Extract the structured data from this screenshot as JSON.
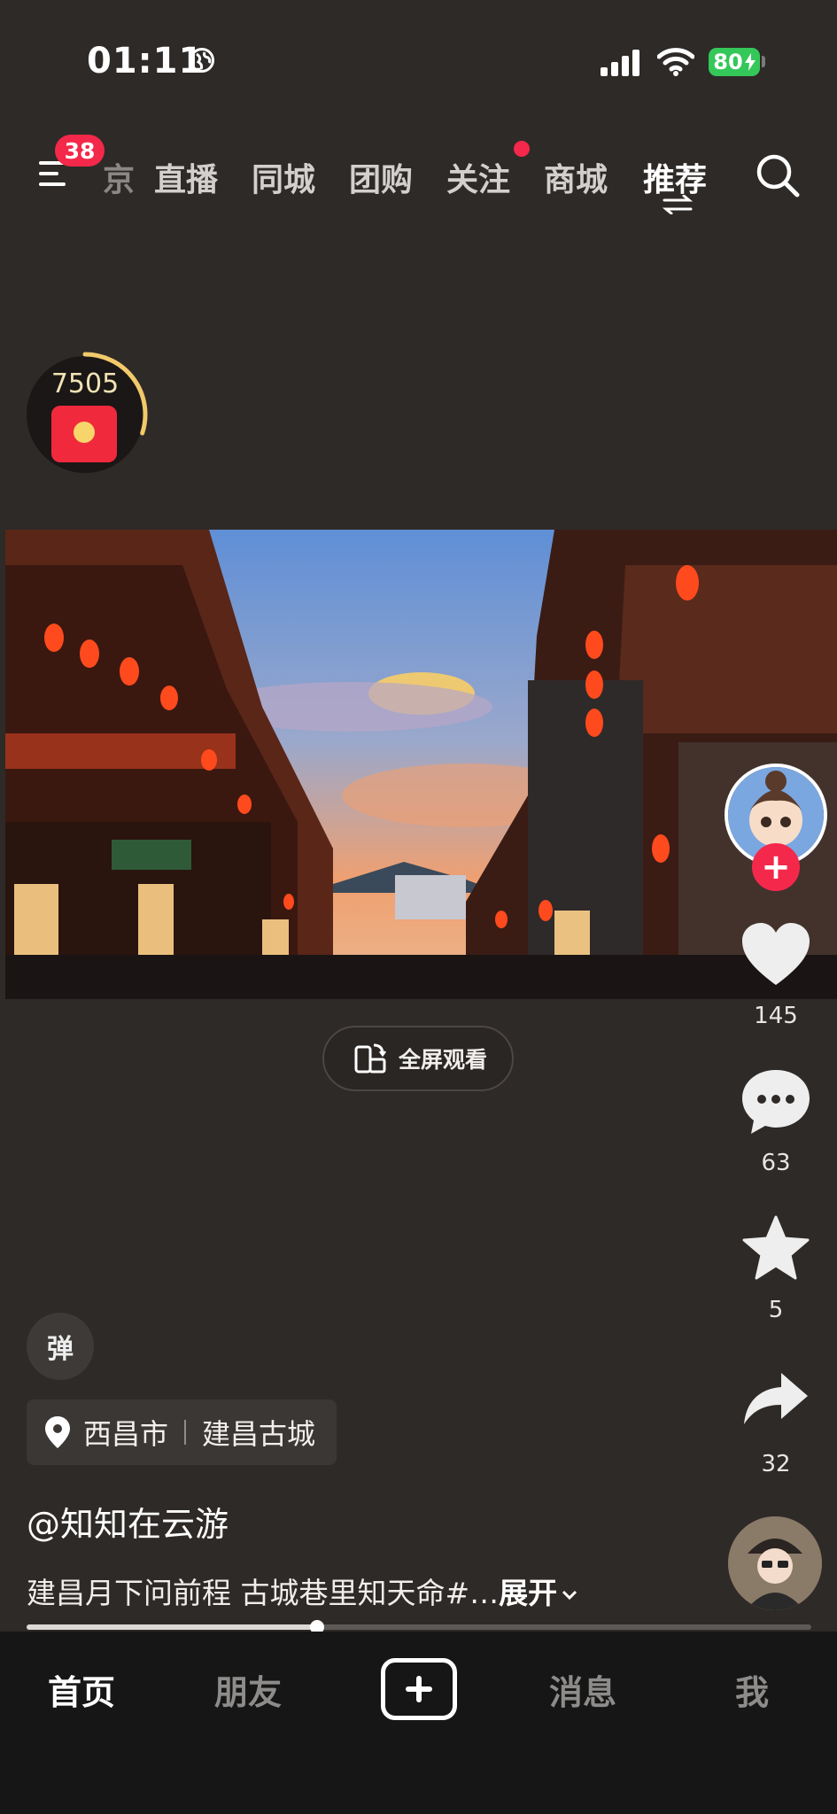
{
  "status_bar": {
    "time": "01:11",
    "battery": "80"
  },
  "top_nav": {
    "menu_badge": "38",
    "tabs": [
      {
        "label": "京",
        "state": "clipped"
      },
      {
        "label": "直播",
        "state": "normal"
      },
      {
        "label": "同城",
        "state": "normal"
      },
      {
        "label": "团购",
        "state": "normal"
      },
      {
        "label": "关注",
        "state": "normal"
      },
      {
        "label": "商城",
        "state": "normal"
      },
      {
        "label": "推荐",
        "state": "active"
      }
    ]
  },
  "red_packet": {
    "count": "7505",
    "progress": 0.3
  },
  "video": {
    "fullscreen_label": "全屏观看"
  },
  "right_rail": {
    "likes": "145",
    "comments": "63",
    "favorites": "5",
    "shares": "32"
  },
  "danmu_label": "弹",
  "location": {
    "city": "西昌市",
    "place": "建昌古城"
  },
  "author": "@知知在云游",
  "caption": {
    "text": "建昌月下问前程 古城巷里知天命#…",
    "more": "展开"
  },
  "playback": {
    "progress": 0.37
  },
  "bottom_tabs": [
    {
      "label": "首页",
      "active": true
    },
    {
      "label": "朋友",
      "active": false
    },
    {
      "label": "消息",
      "active": false
    },
    {
      "label": "我",
      "active": false
    }
  ],
  "colors": {
    "accent": "#f4284a",
    "background": "#2e2a27",
    "tabbar": "#161616"
  }
}
